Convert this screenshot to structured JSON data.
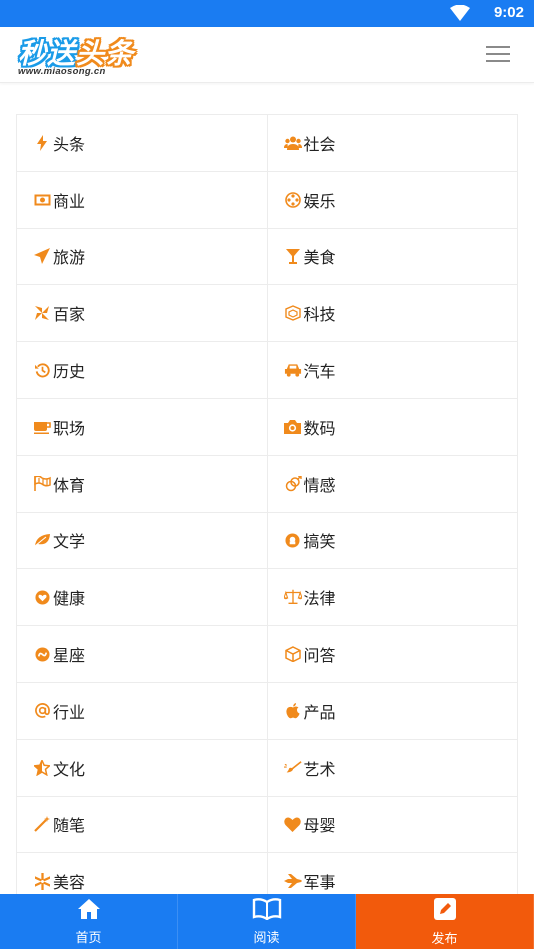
{
  "status": {
    "time": "9:02"
  },
  "header": {
    "logo_main_a": "秒送",
    "logo_main_b": "头条",
    "logo_url": "www.miaosong.cn",
    "menu_icon": "hamburger-icon"
  },
  "colors": {
    "accent": "#1a7cf2",
    "icon": "#f08a1c",
    "publish": "#f25a0c"
  },
  "categories": [
    {
      "label": "头条",
      "icon": "bolt-icon"
    },
    {
      "label": "社会",
      "icon": "users-icon"
    },
    {
      "label": "商业",
      "icon": "money-icon"
    },
    {
      "label": "娱乐",
      "icon": "film-reel-icon"
    },
    {
      "label": "旅游",
      "icon": "paper-plane-icon"
    },
    {
      "label": "美食",
      "icon": "cocktail-icon"
    },
    {
      "label": "百家",
      "icon": "pinwheel-icon"
    },
    {
      "label": "科技",
      "icon": "chip-icon"
    },
    {
      "label": "历史",
      "icon": "history-icon"
    },
    {
      "label": "汽车",
      "icon": "car-icon"
    },
    {
      "label": "职场",
      "icon": "coffee-icon"
    },
    {
      "label": "数码",
      "icon": "camera-icon"
    },
    {
      "label": "体育",
      "icon": "flags-icon"
    },
    {
      "label": "情感",
      "icon": "gender-icon"
    },
    {
      "label": "文学",
      "icon": "leaf-icon"
    },
    {
      "label": "搞笑",
      "icon": "smile-icon"
    },
    {
      "label": "健康",
      "icon": "heart-circle-icon"
    },
    {
      "label": "法律",
      "icon": "scale-icon"
    },
    {
      "label": "星座",
      "icon": "star-sign-icon"
    },
    {
      "label": "问答",
      "icon": "cube-icon"
    },
    {
      "label": "行业",
      "icon": "at-icon"
    },
    {
      "label": "产品",
      "icon": "apple-icon"
    },
    {
      "label": "文化",
      "icon": "star-half-icon"
    },
    {
      "label": "艺术",
      "icon": "paint-icon"
    },
    {
      "label": "随笔",
      "icon": "magic-wand-icon"
    },
    {
      "label": "母婴",
      "icon": "heart-icon"
    },
    {
      "label": "美容",
      "icon": "sparkle-icon"
    },
    {
      "label": "军事",
      "icon": "fighter-jet-icon"
    }
  ],
  "tabs": [
    {
      "label": "首页",
      "icon": "home-icon"
    },
    {
      "label": "阅读",
      "icon": "book-icon"
    },
    {
      "label": "发布",
      "icon": "edit-icon"
    }
  ]
}
